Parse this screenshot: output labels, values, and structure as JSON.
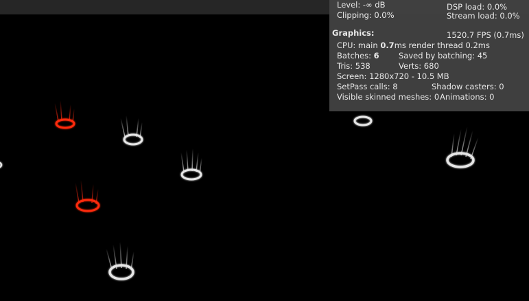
{
  "audio": {
    "level": "Level: -∞ dB",
    "clipping": "Clipping: 0.0%",
    "dsp_load": "DSP load: 0.0%",
    "stream_load": "Stream load: 0.0%"
  },
  "graphics": {
    "heading": "Graphics:",
    "fps": "1520.7 FPS (0.7ms)",
    "cpu_prefix": "CPU: main ",
    "cpu_main": "0.7",
    "cpu_suffix": "ms  render thread 0.2ms",
    "batches_label": "Batches: ",
    "batches_value": "6",
    "saved_by_batching": "Saved by batching: 45",
    "tris": "Tris: 538",
    "verts": "Verts: 680",
    "screen": "Screen: 1280x720 - 10.5 MB",
    "setpass": "SetPass calls: 8",
    "shadow_casters": "Shadow casters: 0",
    "skinned_meshes": "Visible skinned meshes: 0",
    "animations": "Animations: 0"
  },
  "scene": {
    "colors": {
      "white_ring": "#e6e6e6",
      "red_ring": "#ff2a10",
      "background": "#000000"
    },
    "objects": [
      {
        "kind": "red-ring"
      },
      {
        "kind": "white-ring"
      },
      {
        "kind": "white-ring"
      },
      {
        "kind": "red-ring"
      },
      {
        "kind": "white-ring"
      },
      {
        "kind": "white-ring"
      },
      {
        "kind": "white-ring"
      },
      {
        "kind": "white-ring"
      }
    ]
  }
}
